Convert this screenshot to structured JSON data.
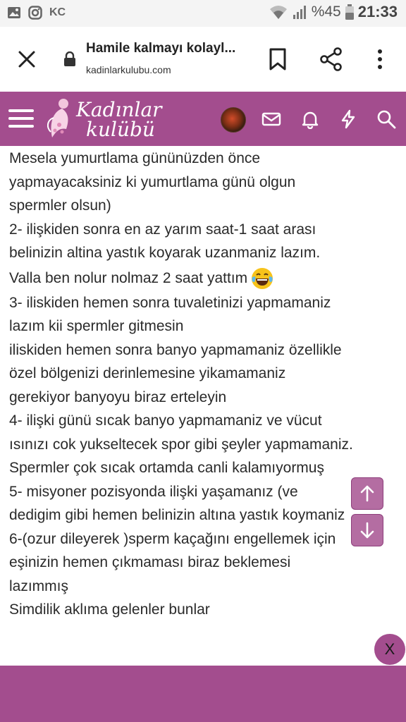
{
  "status_bar": {
    "carrier": "KC",
    "battery_percent": "%45",
    "time": "21:33",
    "icons": [
      "gallery-icon",
      "instagram-icon",
      "wifi-icon",
      "signal-icon",
      "battery-icon"
    ]
  },
  "browser": {
    "page_title": "Hamile kalmayı kolayl...",
    "url": "kadinlarkulubu.com",
    "icons": [
      "close-icon",
      "lock-icon",
      "bookmark-icon",
      "share-icon",
      "more-vert-icon"
    ]
  },
  "site_header": {
    "logo_line1": "Kadınlar",
    "logo_line2": "kulübü",
    "icons": [
      "menu-icon",
      "avatar",
      "mail-icon",
      "bell-icon",
      "lightning-icon",
      "search-icon"
    ],
    "brand_color": "#a34d8e"
  },
  "article": {
    "lines": [
      "Mesela yumurtlama gününüzden önce",
      "yapmayacaksiniz ki yumurtlama günü olgun",
      "spermler olsun)",
      "2- ilişkiden sonra en az yarım saat-1 saat arası",
      "belinizin altina yastık koyarak uzanmaniz lazım.",
      "Valla ben nolur nolmaz 2 saat yattım",
      "3- iliskiden hemen sonra tuvaletinizi yapmamaniz",
      "lazım kii spermler gitmesin",
      "iliskiden hemen sonra banyo yapmamaniz özellikle",
      "özel bölgenizi derinlemesine yikamamaniz",
      "gerekiyor banyoyu biraz erteleyin",
      "4- ilişki günü sıcak banyo yapmamaniz ve vücut",
      "ısınızı cok yukseltecek spor gibi şeyler yapmamaniz.",
      "Spermler çok sıcak ortamda canli kalamıyormuş",
      "5- misyoner pozisyonda ilişki yaşamanız (ve",
      "dedigim gibi hemen belinizin altına yastık koymaniz",
      "6-(ozur dileyerek )sperm kaçağını engellemek için",
      "eşinizin hemen çıkmaması biraz beklemesi",
      "lazımmış",
      "Simdilik aklıma gelenler bunlar"
    ],
    "emoji": "laughing-tears-emoji"
  },
  "floating": {
    "close_label": "X",
    "icons": [
      "arrow-up-icon",
      "arrow-down-icon"
    ]
  }
}
